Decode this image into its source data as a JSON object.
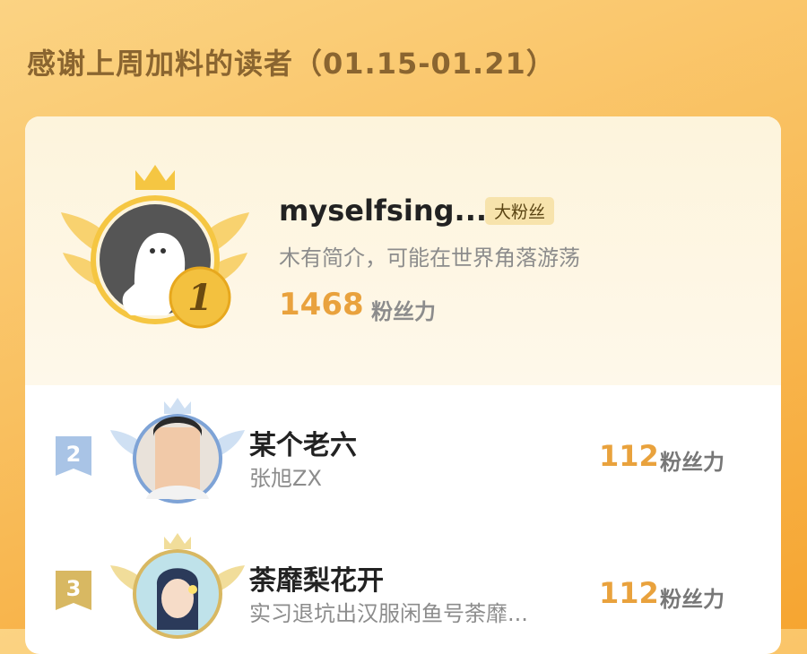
{
  "header": {
    "title": "感谢上周加料的读者（01.15-01.21）"
  },
  "top_reader": {
    "rank": "1",
    "name": "myselfsing...",
    "badge": "大粉丝",
    "bio": "木有简介，可能在世界角落游荡",
    "score": "1468",
    "score_unit": "粉丝力"
  },
  "readers": [
    {
      "rank": "2",
      "name": "某个老六",
      "subtitle": "张旭ZX",
      "score": "112",
      "score_unit": "粉丝力"
    },
    {
      "rank": "3",
      "name": "荼靡梨花开",
      "subtitle": "实习退坑出汉服闲鱼号荼靡...",
      "score": "112",
      "score_unit": "粉丝力"
    }
  ],
  "colors": {
    "accent": "#e9a23d",
    "gold": "#f5c642",
    "silver": "#a9c4e6",
    "bronze": "#d8b862"
  }
}
